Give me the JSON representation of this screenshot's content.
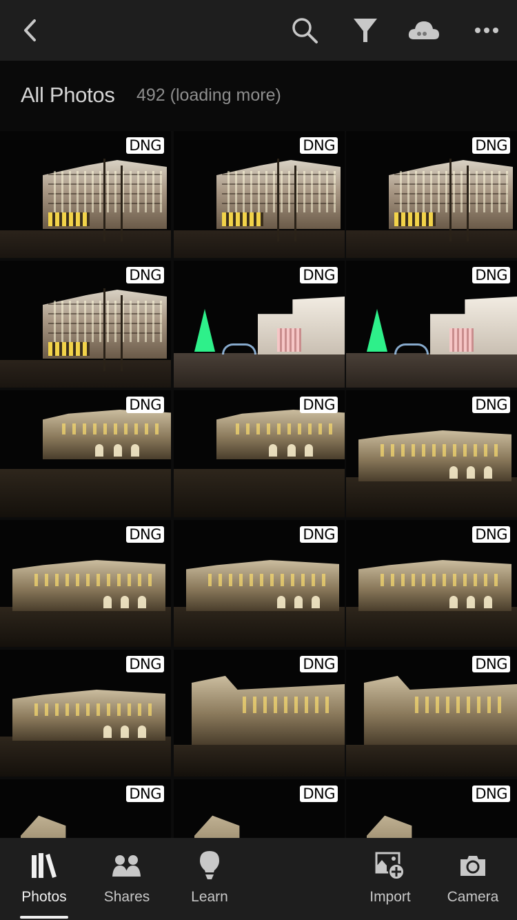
{
  "topbar": {
    "back": "back-chevron-icon",
    "actions": [
      "search-icon",
      "filter-icon",
      "cloud-icon",
      "more-icon"
    ]
  },
  "header": {
    "title": "All Photos",
    "count": "492 (loading more)"
  },
  "grid": {
    "columns": 3,
    "photos": [
      {
        "scene": "hotel",
        "badge": "DNG"
      },
      {
        "scene": "hotel",
        "badge": "DNG"
      },
      {
        "scene": "hotel",
        "badge": "DNG"
      },
      {
        "scene": "hotel",
        "badge": "DNG"
      },
      {
        "scene": "square",
        "badge": "DNG"
      },
      {
        "scene": "square",
        "badge": "DNG"
      },
      {
        "scene": "opera-far",
        "badge": "DNG"
      },
      {
        "scene": "opera-far",
        "badge": "DNG"
      },
      {
        "scene": "opera-mid",
        "badge": "DNG"
      },
      {
        "scene": "opera-mid",
        "badge": "DNG"
      },
      {
        "scene": "opera-mid",
        "badge": "DNG"
      },
      {
        "scene": "opera-mid",
        "badge": "DNG"
      },
      {
        "scene": "opera-mid",
        "badge": "DNG"
      },
      {
        "scene": "opera-close",
        "badge": "DNG"
      },
      {
        "scene": "opera-close",
        "badge": "DNG"
      },
      {
        "scene": "opera-top",
        "badge": "DNG"
      },
      {
        "scene": "opera-top",
        "badge": "DNG"
      },
      {
        "scene": "opera-top",
        "badge": "DNG"
      }
    ]
  },
  "tabs": [
    {
      "id": "photos",
      "label": "Photos",
      "icon": "library-icon",
      "active": true
    },
    {
      "id": "shares",
      "label": "Shares",
      "icon": "people-icon",
      "active": false
    },
    {
      "id": "learn",
      "label": "Learn",
      "icon": "lightbulb-icon",
      "active": false
    },
    {
      "id": "import",
      "label": "Import",
      "icon": "import-photo-icon",
      "active": false
    },
    {
      "id": "camera",
      "label": "Camera",
      "icon": "camera-icon",
      "active": false
    }
  ],
  "colors": {
    "bar_bg": "#1e1e1e",
    "page_bg": "#0a0a0a",
    "icon": "#c8c8c8",
    "active": "#f0f0f0",
    "badge_bg": "#ffffff"
  }
}
